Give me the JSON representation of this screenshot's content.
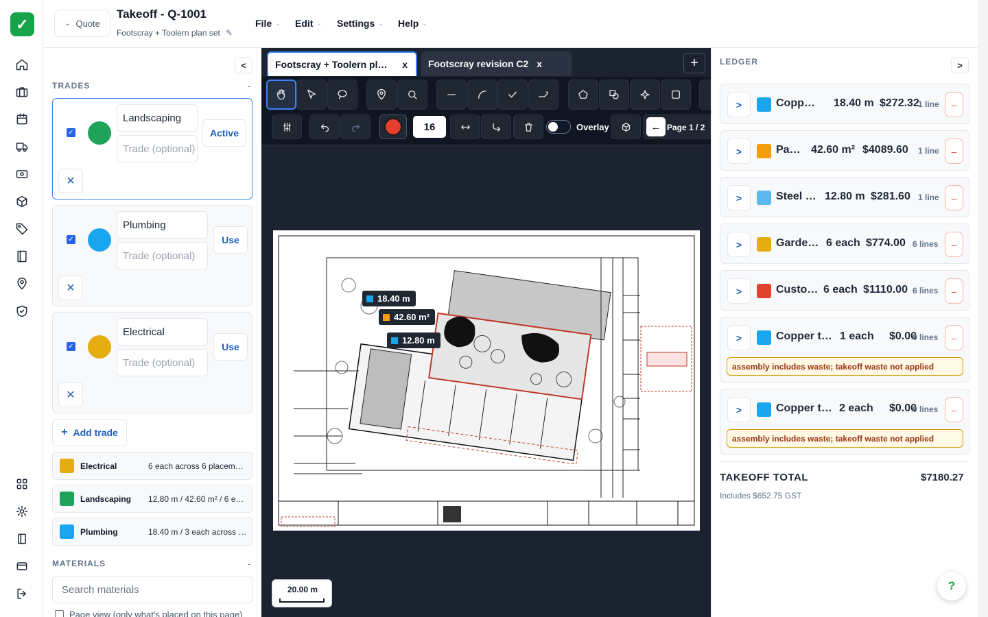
{
  "app": {
    "title": "Takeoff - Q-1001",
    "subtitle": "Footscray + Toolern plan set",
    "quote_label": "Quote"
  },
  "menus": [
    {
      "label": "File"
    },
    {
      "label": "Edit"
    },
    {
      "label": "Settings"
    },
    {
      "label": "Help"
    }
  ],
  "nav": {
    "icons": [
      "home-icon",
      "briefcase-icon",
      "calendar-icon",
      "truck-icon",
      "cash-icon",
      "box-icon",
      "tag-icon",
      "book-icon",
      "map-pin-icon",
      "shield-icon",
      "grid-icon",
      "gear-icon",
      "panel-icon",
      "card-icon",
      "logout-icon"
    ]
  },
  "trades_section": {
    "heading": "TRADES",
    "collapse": "<",
    "dash": "-",
    "cards": [
      {
        "name": "Landscaping",
        "placeholder": "Trade (optional)",
        "action": "Active",
        "color": "#1fa25a"
      },
      {
        "name": "Plumbing",
        "placeholder": "Trade (optional)",
        "action": "Use",
        "color": "#1aa5ef"
      },
      {
        "name": "Electrical",
        "placeholder": "Trade (optional)",
        "action": "Use",
        "color": "#e5ad0f"
      }
    ],
    "add_trade": "Add trade",
    "summary": [
      {
        "name": "Electrical",
        "value": "6 each across 6 placeme…",
        "color": "#e5ad0f"
      },
      {
        "name": "Landscaping",
        "value": "12.80 m / 42.60 m² / 6 ea…",
        "color": "#1fa25a"
      },
      {
        "name": "Plumbing",
        "value": "18.40 m / 3 each across 1…",
        "color": "#1aa5ef"
      }
    ]
  },
  "materials": {
    "heading": "MATERIALS",
    "dash": "-",
    "search_placeholder": "Search materials",
    "page_view_label": "Page view (only what's placed on this page)"
  },
  "tabs": [
    {
      "label": "Footscray + Toolern pl…",
      "close": "x"
    },
    {
      "label": "Footscray revision C2",
      "close": "x"
    }
  ],
  "toolbar": {
    "stroke_width": "16",
    "overlay_label": "Overlay",
    "page_label": "Page 1 / 2",
    "color": "#e53e2f"
  },
  "measurements": [
    {
      "label": "18.40 m",
      "color": "#1aa5ef"
    },
    {
      "label": "42.60 m²",
      "color": "#f59e0b"
    },
    {
      "label": "12.80 m",
      "color": "#1aa5ef"
    }
  ],
  "scale_label": "20.00 m",
  "ledger": {
    "heading": "LEDGER",
    "expand": ">",
    "rows": [
      {
        "name": "Copp…",
        "qty": "18.40 m",
        "cost": "$272.32",
        "lines": "1 line",
        "color": "#1aa5ef"
      },
      {
        "name": "Pa…",
        "qty": "42.60 m²",
        "cost": "$4089.60",
        "lines": "1 line",
        "color": "#f59e0b"
      },
      {
        "name": "Steel …",
        "qty": "12.80 m",
        "cost": "$281.60",
        "lines": "1 line",
        "color": "#5bb8ee"
      },
      {
        "name": "Garde…",
        "qty": "6 each",
        "cost": "$774.00",
        "lines": "6 lines",
        "color": "#e5ad0f"
      },
      {
        "name": "Custo…",
        "qty": "6 each",
        "cost": "$1110.00",
        "lines": "6 lines",
        "color": "#e0442f"
      },
      {
        "name": "Copper t…",
        "qty": "1 each",
        "cost": "$0.00",
        "lines": "0 lines",
        "color": "#1aa5ef",
        "warning": "assembly includes waste; takeoff waste not applied"
      },
      {
        "name": "Copper t…",
        "qty": "2 each",
        "cost": "$0.00",
        "lines": "0 lines",
        "color": "#1aa5ef",
        "warning": "assembly includes waste; takeoff waste not applied"
      }
    ],
    "total_label": "TAKEOFF TOTAL",
    "total_value": "$7180.27",
    "gst": "Includes $652.75 GST"
  },
  "help": "?"
}
